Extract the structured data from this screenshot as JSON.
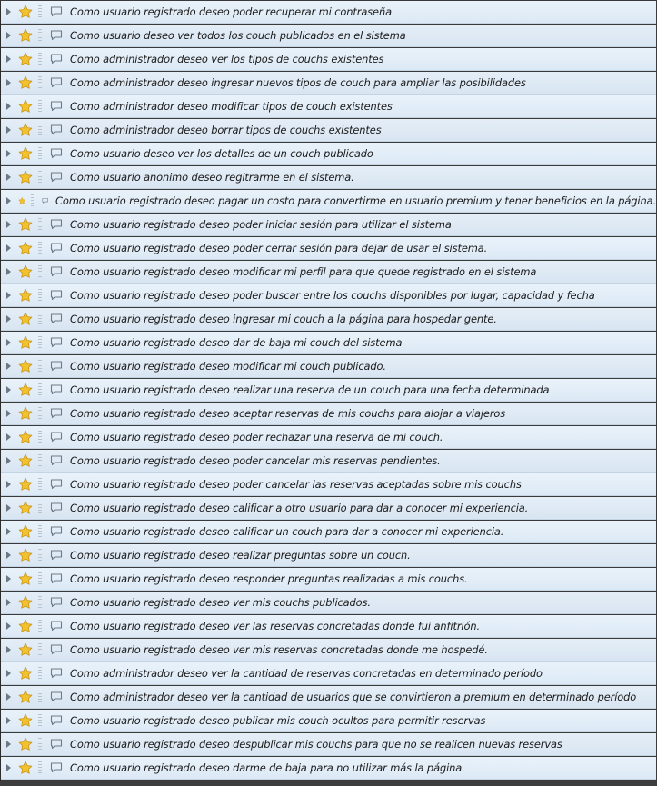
{
  "stories": [
    "Como usuario registrado deseo poder recuperar mi contraseña",
    "Como usuario deseo ver todos los couch publicados en el sistema",
    "Como administrador deseo ver los tipos de couchs existentes",
    "Como administrador deseo ingresar nuevos tipos de couch para ampliar las posibilidades",
    "Como administrador deseo modificar tipos de couch existentes",
    "Como administrador deseo borrar tipos de couchs existentes",
    "Como usuario deseo ver los detalles de un couch publicado",
    "Como usuario anonimo deseo regitrarme en el sistema.",
    "Como usuario registrado deseo pagar un costo para convertirme en usuario premium y tener beneficios en la página.",
    "Como usuario registrado deseo poder iniciar sesión para utilizar el sistema",
    "Como usuario registrado deseo poder cerrar sesión para dejar de usar el sistema.",
    "Como usuario registrado deseo modificar mi perfil para que quede registrado en el sistema",
    "Como usuario registrado deseo poder buscar entre los couchs disponibles por lugar, capacidad y fecha",
    "Como usuario registrado deseo ingresar mi couch a la página para hospedar gente.",
    "Como usuario registrado deseo dar de baja mi couch del sistema",
    "Como usuario registrado deseo modificar mi couch publicado.",
    "Como usuario registrado deseo realizar una reserva de un couch para una fecha determinada",
    "Como usuario registrado deseo aceptar reservas de mis couchs para alojar a viajeros",
    "Como usuario registrado deseo poder rechazar una reserva de mi couch.",
    "Como usuario registrado deseo poder cancelar mis reservas pendientes.",
    "Como usuario registrado deseo poder cancelar las reservas aceptadas sobre mis couchs",
    "Como usuario registrado deseo calificar a otro usuario para dar a conocer mi experiencia.",
    "Como usuario registrado deseo calificar un couch para dar a conocer mi experiencia.",
    "Como usuario registrado deseo realizar preguntas sobre un couch.",
    "Como usuario registrado deseo responder preguntas realizadas a mis couchs.",
    "Como usuario registrado deseo ver mis couchs publicados.",
    "Como usuario registrado deseo ver las reservas concretadas donde fui anfitrión.",
    "Como usuario registrado deseo ver mis reservas concretadas donde me hospedé.",
    "Como administrador deseo ver la cantidad de reservas concretadas en determinado período",
    "Como administrador deseo ver la cantidad de usuarios que se convirtieron a premium en determinado período",
    "Como usuario registrado deseo publicar mis couch ocultos para permitir reservas",
    "Como usuario registrado deseo despublicar mis couchs para que no se realicen nuevas reservas",
    "Como usuario registrado deseo darme de baja para no utilizar más la página."
  ],
  "icons": {
    "expander": "chevron-right-icon",
    "star": "star-icon",
    "handle": "drag-handle-icon",
    "comment": "comment-icon"
  },
  "colors": {
    "star": "#f2c12e",
    "row_bg": "#e6eff8",
    "text": "#1a1a1a"
  }
}
